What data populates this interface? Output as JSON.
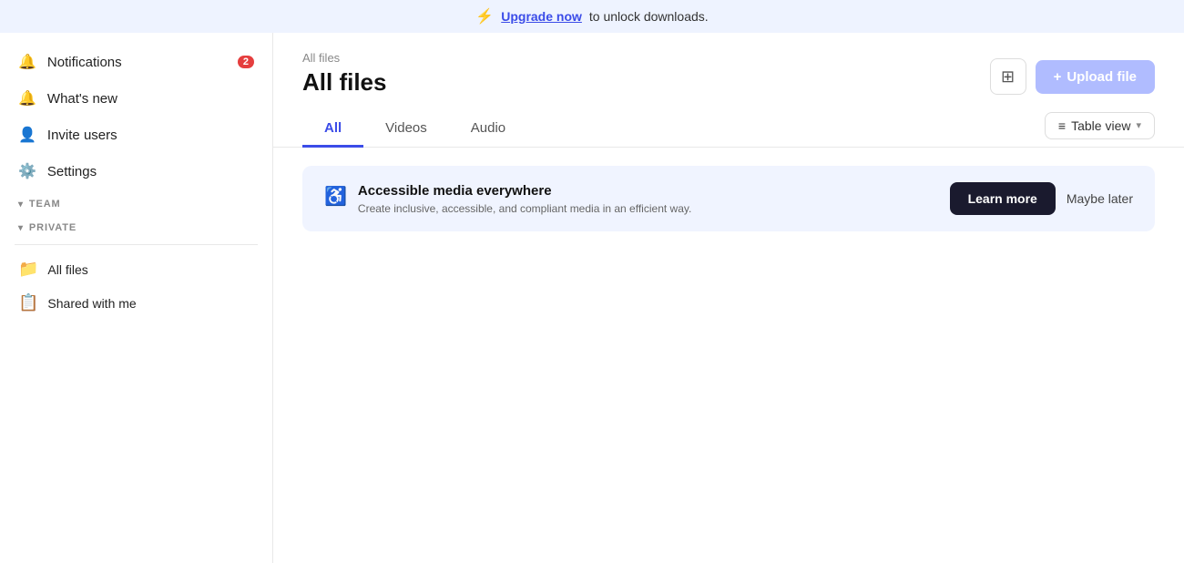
{
  "banner": {
    "bolt_icon": "⚡",
    "upgrade_text": "Upgrade now",
    "rest_text": " to unlock downloads."
  },
  "sidebar": {
    "nav_items": [
      {
        "id": "notifications",
        "label": "Notifications",
        "icon": "🔔",
        "badge": "2"
      },
      {
        "id": "whats-new",
        "label": "What's new",
        "icon": "🔔",
        "badge": null
      }
    ],
    "other_items": [
      {
        "id": "invite-users",
        "label": "Invite users",
        "icon": "👤"
      },
      {
        "id": "settings",
        "label": "Settings",
        "icon": "⚙️"
      }
    ],
    "sections": [
      {
        "id": "team",
        "label": "TEAM"
      },
      {
        "id": "private",
        "label": "PRIVATE"
      }
    ],
    "folders": [
      {
        "id": "all-files",
        "label": "All files",
        "icon": "📁"
      },
      {
        "id": "shared-with-me",
        "label": "Shared with me",
        "icon": "📋"
      }
    ]
  },
  "content": {
    "breadcrumb": "All files",
    "title": "All files",
    "upload_icon": "+",
    "upload_label": "Upload file",
    "tabs": [
      {
        "id": "all",
        "label": "All",
        "active": true
      },
      {
        "id": "videos",
        "label": "Videos",
        "active": false
      },
      {
        "id": "audio",
        "label": "Audio",
        "active": false
      }
    ],
    "view_switcher_label": "Table view"
  },
  "promo": {
    "icon": "♿",
    "title": "Accessible media everywhere",
    "description": "Create inclusive, accessible, and compliant media in an efficient way.",
    "learn_more_label": "Learn more",
    "maybe_later_label": "Maybe later"
  }
}
